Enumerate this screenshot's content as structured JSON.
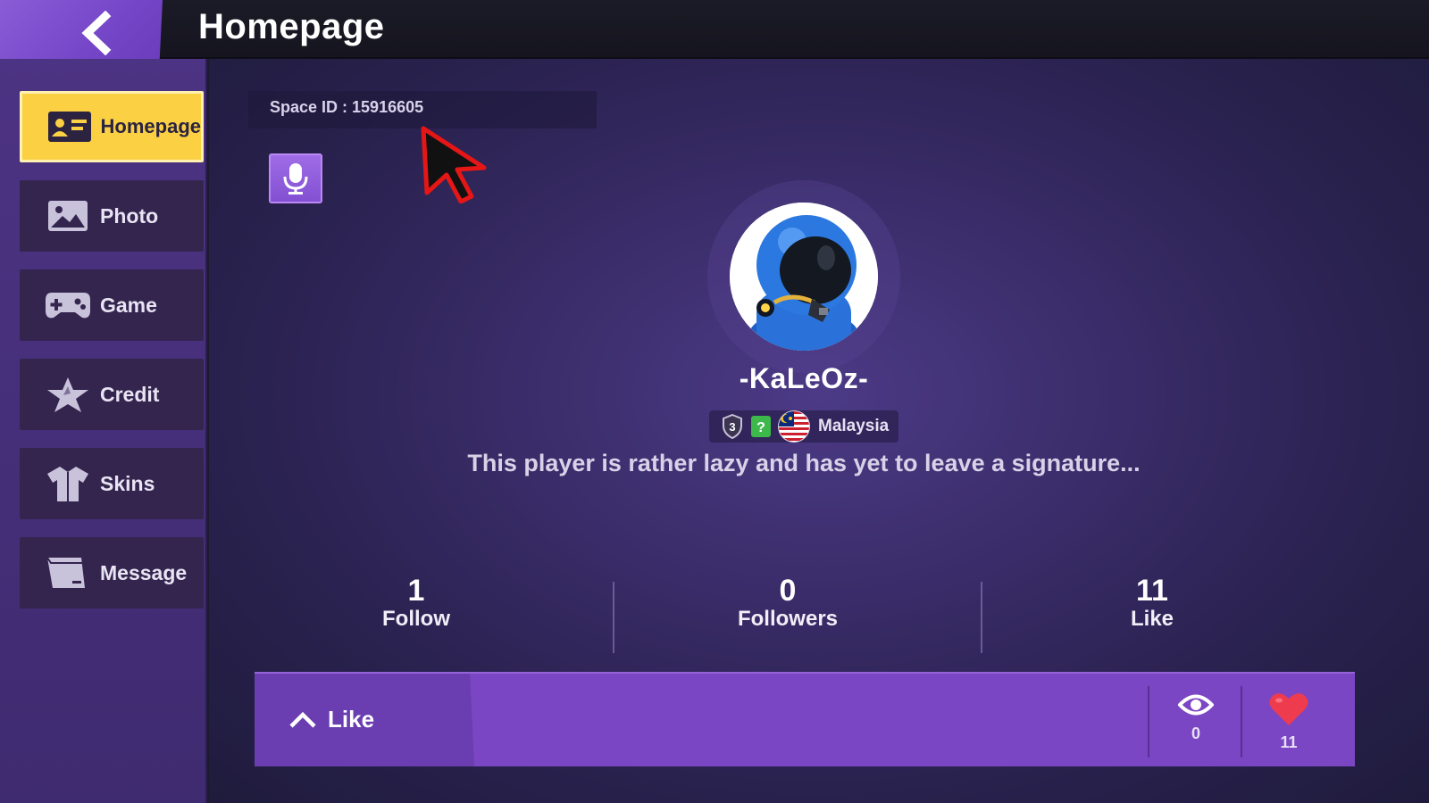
{
  "header": {
    "title": "Homepage"
  },
  "sidebar": {
    "items": [
      {
        "label": "Homepage",
        "icon": "id-card-icon",
        "active": true
      },
      {
        "label": "Photo",
        "icon": "photo-icon"
      },
      {
        "label": "Game",
        "icon": "gamepad-icon"
      },
      {
        "label": "Credit",
        "icon": "star-icon"
      },
      {
        "label": "Skins",
        "icon": "shirt-icon"
      },
      {
        "label": "Message",
        "icon": "message-icon"
      }
    ]
  },
  "profile": {
    "space_id": "Space ID : 15916605",
    "username": "-KaLeOz-",
    "level_badge": "3",
    "help_badge": "?",
    "country": "Malaysia",
    "signature": "This player is rather lazy and has yet to leave a signature..."
  },
  "stats": [
    {
      "value": "1",
      "label": "Follow"
    },
    {
      "value": "0",
      "label": "Followers"
    },
    {
      "value": "11",
      "label": "Like"
    }
  ],
  "like_bar": {
    "label": "Like",
    "views": "0",
    "likes": "11"
  },
  "colors": {
    "accent": "#7b46c3",
    "active_nav": "#fbd143",
    "heart": "#ef3b4e"
  }
}
